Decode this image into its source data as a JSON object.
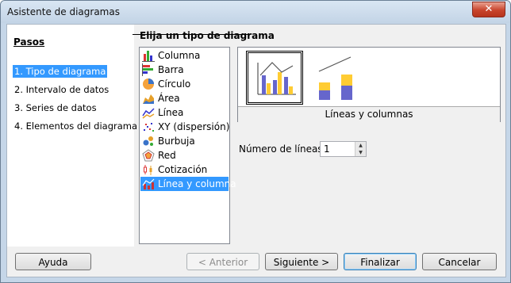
{
  "window": {
    "title": "Asistente de diagramas",
    "close_label": "✕"
  },
  "steps": {
    "title": "Pasos",
    "items": [
      {
        "label": "1. Tipo de diagrama",
        "active": true
      },
      {
        "label": "2. Intervalo de datos",
        "active": false
      },
      {
        "label": "3. Series de datos",
        "active": false
      },
      {
        "label": "4. Elementos del diagrama",
        "active": false
      }
    ]
  },
  "chart_type": {
    "heading": "Elija un tipo de diagrama",
    "types": [
      {
        "label": "Columna",
        "icon": "column-chart-icon"
      },
      {
        "label": "Barra",
        "icon": "bar-chart-icon"
      },
      {
        "label": "Círculo",
        "icon": "pie-chart-icon"
      },
      {
        "label": "Área",
        "icon": "area-chart-icon"
      },
      {
        "label": "Línea",
        "icon": "line-chart-icon"
      },
      {
        "label": "XY (dispersión)",
        "icon": "scatter-chart-icon"
      },
      {
        "label": "Burbuja",
        "icon": "bubble-chart-icon"
      },
      {
        "label": "Red",
        "icon": "net-chart-icon"
      },
      {
        "label": "Cotización",
        "icon": "stock-chart-icon"
      },
      {
        "label": "Línea y columna",
        "icon": "line-column-chart-icon",
        "selected": true
      }
    ],
    "variant_caption": "Líneas y columnas",
    "lines_label": "Número de líneas",
    "lines_value": "1"
  },
  "buttons": {
    "help": "Ayuda",
    "back": "< Anterior",
    "next": "Siguiente >",
    "finish": "Finalizar",
    "cancel": "Cancelar"
  },
  "colors": {
    "selection": "#3399ff",
    "series_blue": "#6666cc",
    "series_yellow": "#ffcc33"
  }
}
